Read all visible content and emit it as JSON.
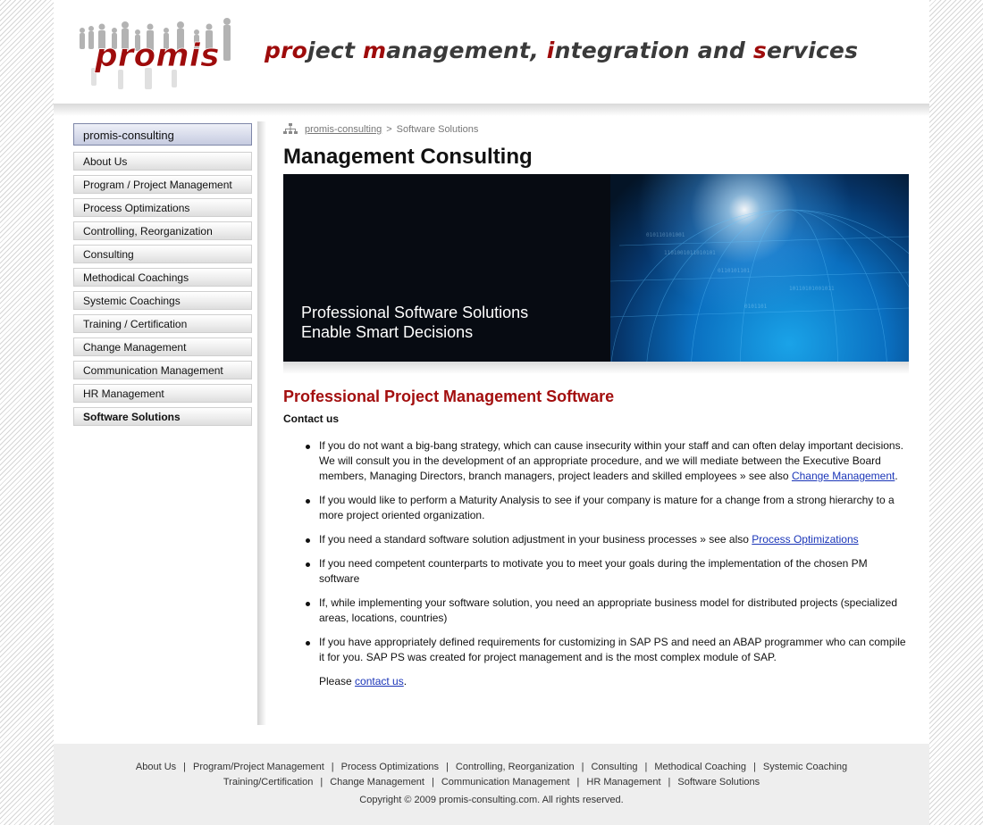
{
  "header": {
    "logo_text": "promis",
    "tagline_parts": [
      {
        "text": "pro",
        "red": true
      },
      {
        "text": "ject ",
        "red": false
      },
      {
        "text": "m",
        "red": true
      },
      {
        "text": "anagement, ",
        "red": false
      },
      {
        "text": "i",
        "red": true
      },
      {
        "text": "ntegration and ",
        "red": false
      },
      {
        "text": "s",
        "red": true
      },
      {
        "text": "ervices",
        "red": false
      }
    ]
  },
  "sidebar": {
    "heading": "promis-consulting",
    "items": [
      {
        "label": "About Us",
        "active": false
      },
      {
        "label": "Program / Project Management",
        "active": false
      },
      {
        "label": "Process Optimizations",
        "active": false
      },
      {
        "label": "Controlling, Reorganization",
        "active": false
      },
      {
        "label": "Consulting",
        "active": false
      },
      {
        "label": "Methodical Coachings",
        "active": false
      },
      {
        "label": "Systemic Coachings",
        "active": false
      },
      {
        "label": "Training / Certification",
        "active": false
      },
      {
        "label": "Change Management",
        "active": false
      },
      {
        "label": "Communication Management",
        "active": false
      },
      {
        "label": "HR Management",
        "active": false
      },
      {
        "label": "Software Solutions",
        "active": true
      }
    ]
  },
  "breadcrumb": {
    "home": "promis-consulting",
    "separator": ">",
    "current": "Software Solutions"
  },
  "main": {
    "title": "Management Consulting",
    "banner_line1": "Professional Software Solutions",
    "banner_line2": "Enable Smart Decisions",
    "section_title": "Professional Project Management Software",
    "contact_heading": "Contact us",
    "bullets": [
      {
        "text": "If you do not want a big-bang strategy, which can cause insecurity within your staff and can often delay important decisions. We will consult you in the development of an appropriate procedure, and we will mediate between the Executive Board members, Managing Directors, branch managers, project leaders and skilled employees » see also ",
        "link": "Change Management",
        "after": "."
      },
      {
        "text": "If you would like to perform a Maturity Analysis to see if your company is mature for a change from a strong hierarchy to a more project oriented organization.",
        "link": "",
        "after": ""
      },
      {
        "text": "If you need a standard software solution adjustment in your business processes » see also ",
        "link": "Process Optimizations",
        "after": ""
      },
      {
        "text": "If you need competent counterparts to motivate you to meet your goals during the implementation of the chosen PM software",
        "link": "",
        "after": ""
      },
      {
        "text": "If, while implementing your software solution, you need an appropriate business model for distributed projects (specialized areas, locations, countries)",
        "link": "",
        "after": ""
      },
      {
        "text": "If you have appropriately defined requirements for customizing in SAP PS and need an ABAP programmer who can compile it for you. SAP PS was created for project management and is the most complex module of SAP.",
        "link": "",
        "after": ""
      }
    ],
    "please_text": "Please ",
    "please_link": "contact us",
    "please_after": "."
  },
  "footer": {
    "row1": [
      "About Us",
      "Program/Project Management",
      "Process Optimizations",
      "Controlling, Reorganization",
      "Consulting",
      "Methodical Coaching",
      "Systemic Coaching"
    ],
    "row2": [
      "Training/Certification",
      "Change Management",
      "Communication Management",
      "HR Management",
      "Software Solutions"
    ],
    "separator": "|",
    "copyright": "Copyright © 2009 promis-consulting.com. All rights reserved."
  },
  "colors": {
    "brand_red": "#9e0b0b",
    "link_blue": "#1a35b8",
    "section_red": "#a30f0f"
  }
}
